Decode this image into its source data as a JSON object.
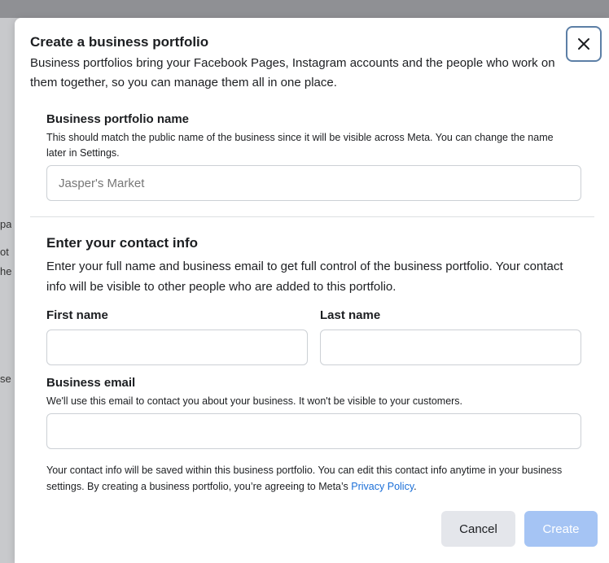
{
  "background": {
    "fragments": [
      "pa",
      "ot",
      "he",
      "se"
    ]
  },
  "modal": {
    "title": "Create a business portfolio",
    "description": "Business portfolios bring your Facebook Pages, Instagram accounts and the people who work on them together, so you can manage them all in one place.",
    "close_icon": "close-icon"
  },
  "portfolio_name": {
    "label": "Business portfolio name",
    "helper": "This should match the public name of the business since it will be visible across Meta. You can change the name later in Settings.",
    "value": "",
    "placeholder": "Jasper's Market"
  },
  "contact": {
    "title": "Enter your contact info",
    "description": "Enter your full name and business email to get full control of the business portfolio. Your contact info will be visible to other people who are added to this portfolio.",
    "first_name_label": "First name",
    "first_name_value": "",
    "last_name_label": "Last name",
    "last_name_value": "",
    "email_label": "Business email",
    "email_helper": "We'll use this email to contact you about your business. It won't be visible to your customers.",
    "email_value": ""
  },
  "footer": {
    "note": "Your contact info will be saved within this business portfolio. You can edit this contact info anytime in your business settings. By creating a business portfolio, you’re agreeing to Meta’s ",
    "privacy_link": "Privacy Policy",
    "period": "."
  },
  "buttons": {
    "cancel": "Cancel",
    "create": "Create"
  },
  "colors": {
    "link": "#1b6fd8",
    "create_disabled": "#a5c4f4",
    "close_border": "#5c7fa6"
  }
}
